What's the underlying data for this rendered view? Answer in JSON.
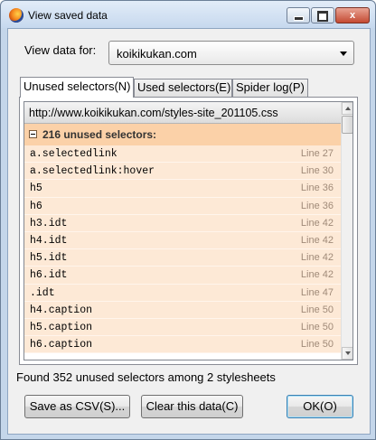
{
  "window": {
    "title": "View saved data",
    "minimize_label": "",
    "close_label": "x"
  },
  "view": {
    "label": "View data for:",
    "selected": "koikikukan.com"
  },
  "tabs": [
    {
      "label": "Unused selectors(N)",
      "active": true
    },
    {
      "label": "Used selectors(E)",
      "active": false
    },
    {
      "label": "Spider log(P)",
      "active": false
    }
  ],
  "list": {
    "stylesheet_url": "http://www.koikikukan.com/styles-site_201105.css",
    "group_label": "216 unused selectors:",
    "rows": [
      {
        "selector": "a.selectedlink",
        "line": "Line 27"
      },
      {
        "selector": "a.selectedlink:hover",
        "line": "Line 30"
      },
      {
        "selector": "h5",
        "line": "Line 36"
      },
      {
        "selector": "h6",
        "line": "Line 36"
      },
      {
        "selector": "h3.idt",
        "line": "Line 42"
      },
      {
        "selector": "h4.idt",
        "line": "Line 42"
      },
      {
        "selector": "h5.idt",
        "line": "Line 42"
      },
      {
        "selector": "h6.idt",
        "line": "Line 42"
      },
      {
        "selector": ".idt",
        "line": "Line 47"
      },
      {
        "selector": "h4.caption",
        "line": "Line 50"
      },
      {
        "selector": "h5.caption",
        "line": "Line 50"
      },
      {
        "selector": "h6.caption",
        "line": "Line 50"
      }
    ]
  },
  "status": "Found 352 unused selectors among 2 stylesheets",
  "buttons": {
    "save_csv": "Save as CSV(S)...",
    "clear": "Clear this data(C)",
    "ok": "OK(O)"
  },
  "colors": {
    "group_header": "#fbd1a8",
    "row_bg": "#fde9d6",
    "line_text": "#a08a78"
  }
}
